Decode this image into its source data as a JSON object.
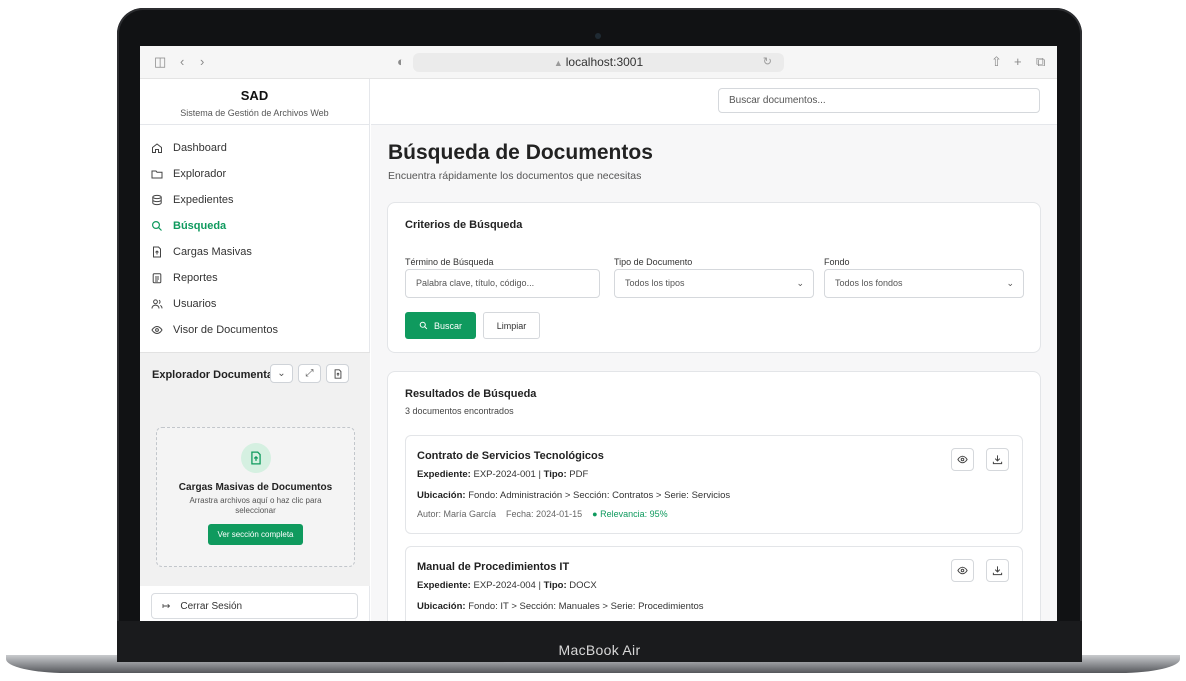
{
  "device": {
    "label": "MacBook Air"
  },
  "browser": {
    "url": "localhost:3001"
  },
  "app": {
    "title": "SAD",
    "subtitle": "Sistema de Gestión de Archivos Web"
  },
  "header": {
    "search_placeholder": "Buscar documentos..."
  },
  "sidebar": {
    "items": [
      {
        "label": "Dashboard",
        "icon": "home-icon"
      },
      {
        "label": "Explorador",
        "icon": "folder-icon"
      },
      {
        "label": "Expedientes",
        "icon": "database-icon"
      },
      {
        "label": "Búsqueda",
        "icon": "search-icon",
        "active": true
      },
      {
        "label": "Cargas Masivas",
        "icon": "upload-file-icon"
      },
      {
        "label": "Reportes",
        "icon": "clipboard-icon"
      },
      {
        "label": "Usuarios",
        "icon": "users-icon"
      },
      {
        "label": "Visor de Documentos",
        "icon": "eye-icon"
      }
    ],
    "explorer_label": "Explorador Documental",
    "dropzone": {
      "title": "Cargas Masivas de Documentos",
      "subtitle": "Arrastra archivos aquí o haz clic para seleccionar",
      "button": "Ver sección completa"
    },
    "logout": "Cerrar Sesión"
  },
  "page": {
    "title": "Búsqueda de Documentos",
    "subtitle": "Encuentra rápidamente los documentos que necesitas"
  },
  "criteria": {
    "title": "Criterios de Búsqueda",
    "term_label": "Término de Búsqueda",
    "term_placeholder": "Palabra clave, título, código...",
    "type_label": "Tipo de Documento",
    "type_value": "Todos los tipos",
    "fondo_label": "Fondo",
    "fondo_value": "Todos los fondos",
    "search_button": "Buscar",
    "clear_button": "Limpiar"
  },
  "results": {
    "title": "Resultados de Búsqueda",
    "count": "3 documentos encontrados",
    "items": [
      {
        "title": "Contrato de Servicios Tecnológicos",
        "exp_label": "Expediente:",
        "exp": "EXP-2024-001",
        "type_label": "Tipo:",
        "type": "PDF",
        "loc_label": "Ubicación:",
        "loc": "Fondo: Administración > Sección: Contratos > Serie: Servicios",
        "author": "Autor: María García",
        "date": "Fecha: 2024-01-15",
        "relevance": "Relevancia: 95%"
      },
      {
        "title": "Manual de Procedimientos IT",
        "exp_label": "Expediente:",
        "exp": "EXP-2024-004",
        "type_label": "Tipo:",
        "type": "DOCX",
        "loc_label": "Ubicación:",
        "loc": "Fondo: IT > Sección: Manuales > Serie: Procedimientos"
      }
    ]
  },
  "colors": {
    "accent": "#0f9a5e",
    "accent_light": "#d5f0e1"
  }
}
